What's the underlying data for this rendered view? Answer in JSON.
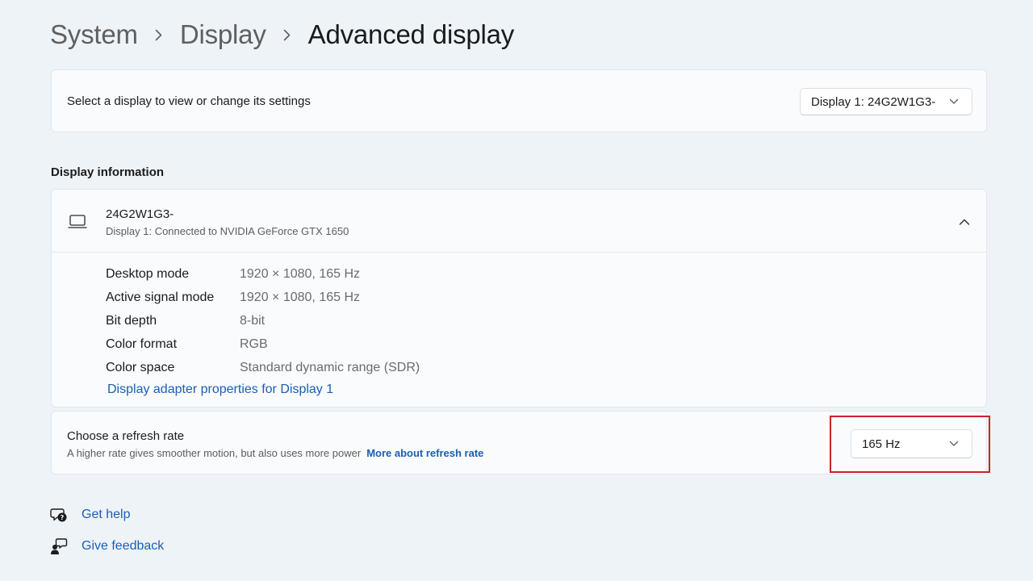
{
  "breadcrumb": {
    "items": [
      "System",
      "Display"
    ],
    "current": "Advanced display"
  },
  "display_selector": {
    "label": "Select a display to view or change its settings",
    "selected": "Display 1: 24G2W1G3-"
  },
  "display_info": {
    "section_title": "Display information",
    "name": "24G2W1G3-",
    "subtitle": "Display 1: Connected to NVIDIA GeForce GTX 1650",
    "rows": [
      {
        "key": "Desktop mode",
        "value": "1920 × 1080, 165 Hz"
      },
      {
        "key": "Active signal mode",
        "value": "1920 × 1080, 165 Hz"
      },
      {
        "key": "Bit depth",
        "value": "8-bit"
      },
      {
        "key": "Color format",
        "value": "RGB"
      },
      {
        "key": "Color space",
        "value": "Standard dynamic range (SDR)"
      }
    ],
    "adapter_link": "Display adapter properties for Display 1"
  },
  "refresh_rate": {
    "title": "Choose a refresh rate",
    "description": "A higher rate gives smoother motion, but also uses more power",
    "link": "More about refresh rate",
    "selected": "165 Hz"
  },
  "footer": {
    "help": "Get help",
    "feedback": "Give feedback"
  },
  "icons": {
    "breadcrumb_separator": "chevron-right-icon",
    "dropdown": "chevron-down-icon",
    "display": "monitor-icon",
    "collapse": "chevron-up-icon",
    "help": "help-icon",
    "feedback": "feedback-icon"
  },
  "colors": {
    "accent_link": "#1a5fb4",
    "highlight": "#c8232b",
    "background": "#eef3f8"
  }
}
